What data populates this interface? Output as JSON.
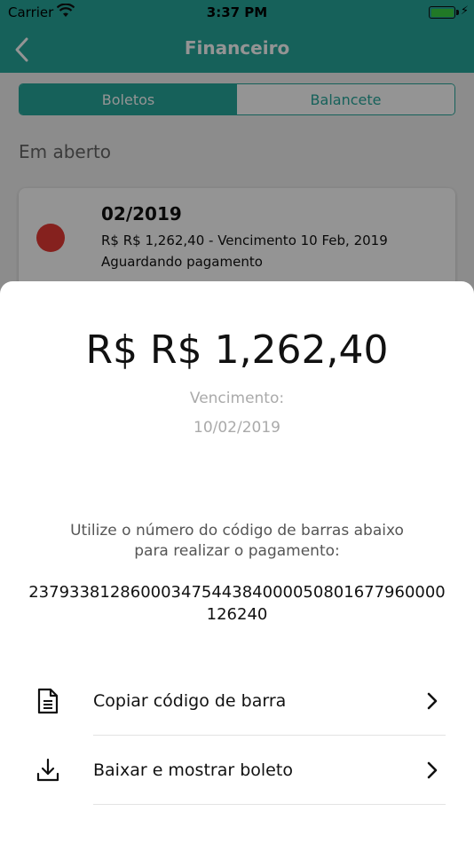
{
  "status_bar": {
    "carrier": "Carrier",
    "time": "3:37 PM"
  },
  "nav": {
    "title": "Financeiro",
    "back_icon": "chevron-left-icon"
  },
  "tabs": [
    {
      "label": "Boletos",
      "active": true
    },
    {
      "label": "Balancete",
      "active": false
    }
  ],
  "section_title": "Em aberto",
  "card": {
    "period": "02/2019",
    "line1": "R$ R$ 1,262,40 - Vencimento 10 Feb, 2019",
    "line2": "Aguardando pagamento",
    "status_color": "#e53935"
  },
  "sheet": {
    "amount": "R$ R$ 1,262,40",
    "due_label": "Vencimento:",
    "due_date": "10/02/2019",
    "instruction": "Utilize o número do código de barras abaixo para realizar o pagamento:",
    "barcode": "23793381286000347544384000050801677960000126240",
    "actions": [
      {
        "label": "Copiar código de barra",
        "icon": "document-icon"
      },
      {
        "label": "Baixar e mostrar boleto",
        "icon": "download-icon"
      }
    ]
  },
  "colors": {
    "accent": "#26a89c",
    "status_red": "#e53935"
  }
}
